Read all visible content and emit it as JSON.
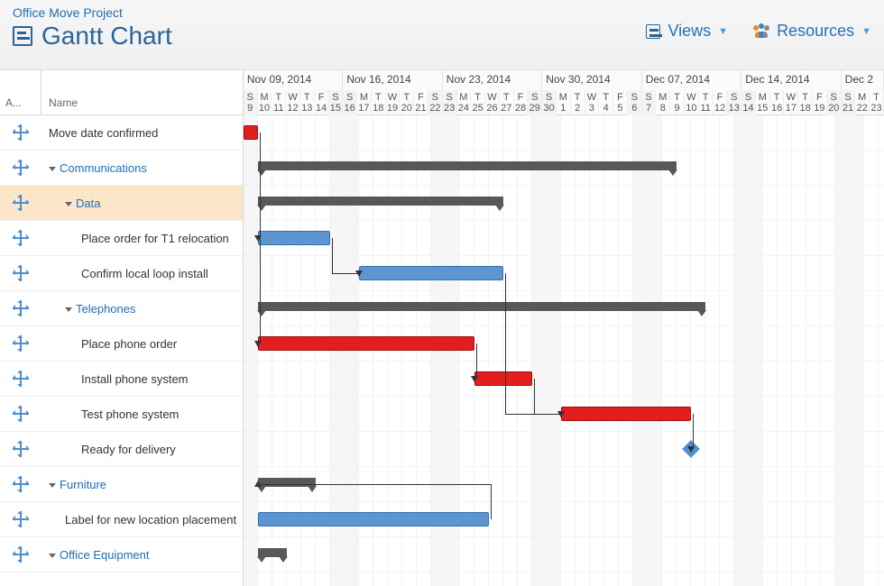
{
  "header": {
    "project": "Office Move Project",
    "title": "Gantt Chart",
    "views_label": "Views",
    "resources_label": "Resources"
  },
  "columns": {
    "c1": "A...",
    "c2": "Name"
  },
  "timeline": {
    "day_width": 16,
    "first_day_offset": -1,
    "weeks": [
      {
        "label": "",
        "days": 1
      },
      {
        "label": "Nov 09, 2014",
        "days": 7
      },
      {
        "label": "Nov 16, 2014",
        "days": 7
      },
      {
        "label": "Nov 23, 2014",
        "days": 7
      },
      {
        "label": "Nov 30, 2014",
        "days": 7
      },
      {
        "label": "Dec 07, 2014",
        "days": 7
      },
      {
        "label": "Dec 14, 2014",
        "days": 7
      },
      {
        "label": "Dec 2",
        "days": 3
      }
    ],
    "day_letters": [
      "S",
      "M",
      "T",
      "W",
      "T",
      "F",
      "S"
    ],
    "day_numbers_start": 9,
    "month_rollover": [
      {
        "after_index": 22,
        "restart_at": 1
      }
    ]
  },
  "tasks": [
    {
      "name": "Move date confirmed",
      "indent": 0,
      "style": "black",
      "collapsible": false,
      "selected": false
    },
    {
      "name": "Communications",
      "indent": 0,
      "style": "link",
      "collapsible": true,
      "selected": false
    },
    {
      "name": "Data",
      "indent": 1,
      "style": "link",
      "collapsible": true,
      "selected": true
    },
    {
      "name": "Place order for T1 relocation",
      "indent": 2,
      "style": "black",
      "collapsible": false,
      "selected": false
    },
    {
      "name": "Confirm local loop install",
      "indent": 2,
      "style": "black",
      "collapsible": false,
      "selected": false
    },
    {
      "name": "Telephones",
      "indent": 1,
      "style": "link",
      "collapsible": true,
      "selected": false
    },
    {
      "name": "Place phone order",
      "indent": 2,
      "style": "black",
      "collapsible": false,
      "selected": false
    },
    {
      "name": "Install phone system",
      "indent": 2,
      "style": "black",
      "collapsible": false,
      "selected": false
    },
    {
      "name": "Test phone system",
      "indent": 2,
      "style": "black",
      "collapsible": false,
      "selected": false
    },
    {
      "name": "Ready for delivery",
      "indent": 2,
      "style": "black",
      "collapsible": false,
      "selected": false
    },
    {
      "name": "Furniture",
      "indent": 0,
      "style": "link",
      "collapsible": true,
      "selected": false
    },
    {
      "name": "Label for new location placement",
      "indent": 1,
      "style": "black",
      "collapsible": false,
      "selected": false
    },
    {
      "name": "Office Equipment",
      "indent": 0,
      "style": "link",
      "collapsible": true,
      "selected": false
    }
  ],
  "chart_data": {
    "type": "gantt",
    "unit": "day index (0 = Nov 09 2014)",
    "bars": [
      {
        "row": 0,
        "kind": "task",
        "color": "red",
        "start": 0,
        "end": 1
      },
      {
        "row": 1,
        "kind": "summary",
        "start": 1,
        "end": 30
      },
      {
        "row": 2,
        "kind": "summary",
        "start": 1,
        "end": 18
      },
      {
        "row": 3,
        "kind": "task",
        "color": "blue",
        "start": 1,
        "end": 6
      },
      {
        "row": 4,
        "kind": "task",
        "color": "blue",
        "start": 8,
        "end": 18
      },
      {
        "row": 5,
        "kind": "summary",
        "start": 1,
        "end": 32
      },
      {
        "row": 6,
        "kind": "task",
        "color": "red",
        "start": 1,
        "end": 16
      },
      {
        "row": 7,
        "kind": "task",
        "color": "red",
        "start": 16,
        "end": 20
      },
      {
        "row": 8,
        "kind": "task",
        "color": "red",
        "start": 22,
        "end": 31
      },
      {
        "row": 9,
        "kind": "milestone",
        "start": 31
      },
      {
        "row": 10,
        "kind": "summary",
        "start": 1,
        "end": 5
      },
      {
        "row": 11,
        "kind": "task",
        "color": "blue",
        "start": 1,
        "end": 17
      },
      {
        "row": 12,
        "kind": "summary",
        "start": 1,
        "end": 3
      }
    ],
    "dependencies": [
      {
        "from_row": 0,
        "to_row": 3
      },
      {
        "from_row": 3,
        "to_row": 4
      },
      {
        "from_row": 4,
        "to_row": 8
      },
      {
        "from_row": 0,
        "to_row": 6
      },
      {
        "from_row": 6,
        "to_row": 7
      },
      {
        "from_row": 7,
        "to_row": 8
      },
      {
        "from_row": 8,
        "to_row": 9
      },
      {
        "from_row": 11,
        "to_row": 10
      }
    ]
  }
}
